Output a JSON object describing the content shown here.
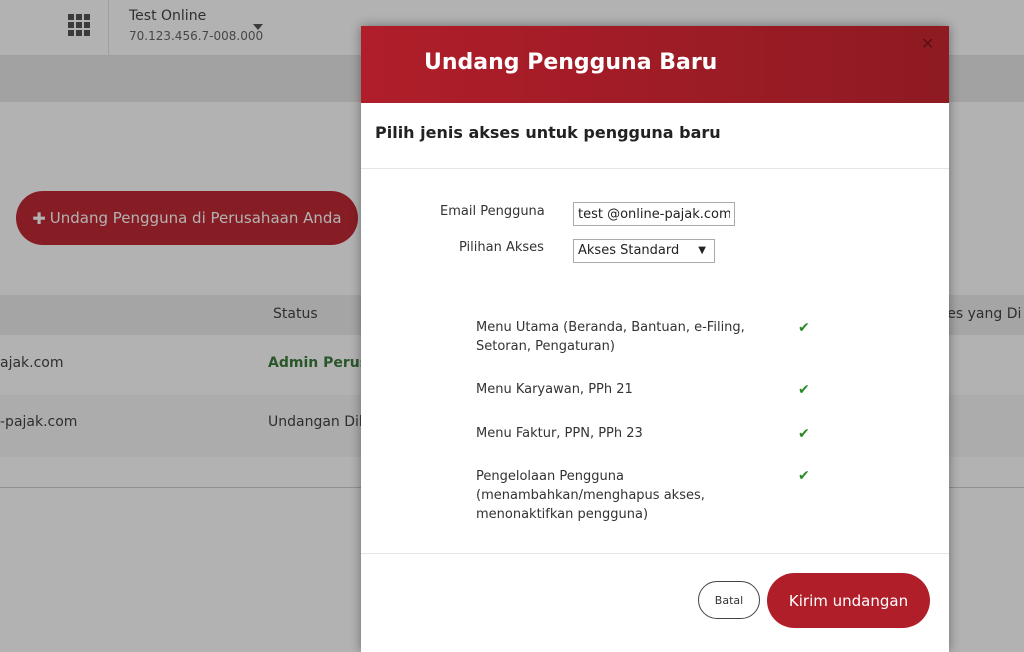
{
  "header": {
    "org_name": "Test Online",
    "org_npwp": "70.123.456.7-008.000",
    "apps_icon": "apps-grid-icon"
  },
  "page": {
    "invite_button_label": "Undang Pengguna di Perusahaan Anda",
    "table": {
      "columns": [
        "Status",
        "ses yang Di"
      ],
      "rows": [
        {
          "email": "ajak.com",
          "status": "Admin Perusa"
        },
        {
          "email": "-pajak.com",
          "status": "Undangan Dik"
        }
      ]
    }
  },
  "modal": {
    "title": "Undang Pengguna Baru",
    "subtitle": "Pilih jenis akses untuk pengguna baru",
    "email_label": "Email Pengguna",
    "email_value": "test @online-pajak.com",
    "access_label": "Pilihan Akses",
    "access_value": "Akses Standard",
    "permissions": [
      {
        "label": "Menu Utama (Beranda, Bantuan, e-Filing, Setoran, Pengaturan)",
        "granted": true
      },
      {
        "label": "Menu Karyawan, PPh 21",
        "granted": true
      },
      {
        "label": "Menu Faktur, PPN, PPh 23",
        "granted": true
      },
      {
        "label": "Pengelolaan Pengguna (menambahkan/menghapus akses, menonaktifkan pengguna)",
        "granted": true
      }
    ],
    "cancel_label": "Batal",
    "send_label": "Kirim undangan"
  },
  "colors": {
    "brand_red": "#b01e2a",
    "check_green": "#2a8a2a",
    "admin_green": "#3c7d3c"
  }
}
